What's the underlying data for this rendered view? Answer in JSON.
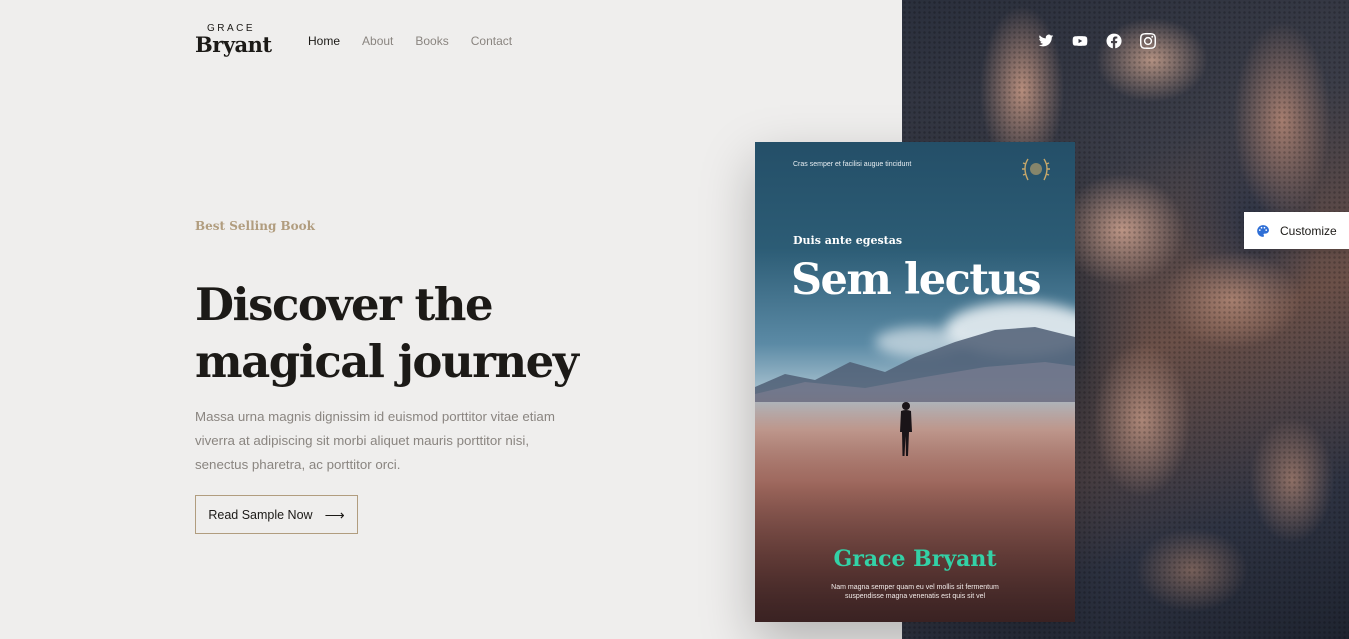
{
  "header": {
    "logo_top": "GRACE",
    "logo_bottom": "Bryant",
    "nav": [
      "Home",
      "About",
      "Books",
      "Contact"
    ],
    "active_nav": "Home",
    "socials": [
      "twitter-icon",
      "youtube-icon",
      "facebook-icon",
      "instagram-icon"
    ]
  },
  "hero": {
    "eyebrow": "Best Selling Book",
    "headline_line1": "Discover the",
    "headline_line2": "magical journey",
    "body": "Massa urna magnis dignissim id euismod porttitor vitae etiam viverra at adipiscing sit morbi aliquet mauris porttitor nisi, senectus pharetra, ac porttitor orci.",
    "cta_label": "Read Sample Now",
    "cta_icon": "arrow-right-icon"
  },
  "book": {
    "top_text": "Cras semper et facilisi augue tincidunt",
    "kicker": "Duis ante egestas",
    "title": "Sem lectus",
    "author": "Grace Bryant",
    "blurb_line1": "Nam magna semper quam eu vel mollis sit fermentum",
    "blurb_line2": "suspendisse magna venenatis est quis sit vel"
  },
  "customize": {
    "label": "Customize",
    "icon": "palette-icon"
  },
  "colors": {
    "accent_gold": "#b19d7f",
    "author_green": "#33d1a6",
    "palette_blue": "#2f6fd6",
    "background": "#efeeed",
    "text_dark": "#1c1a17"
  }
}
